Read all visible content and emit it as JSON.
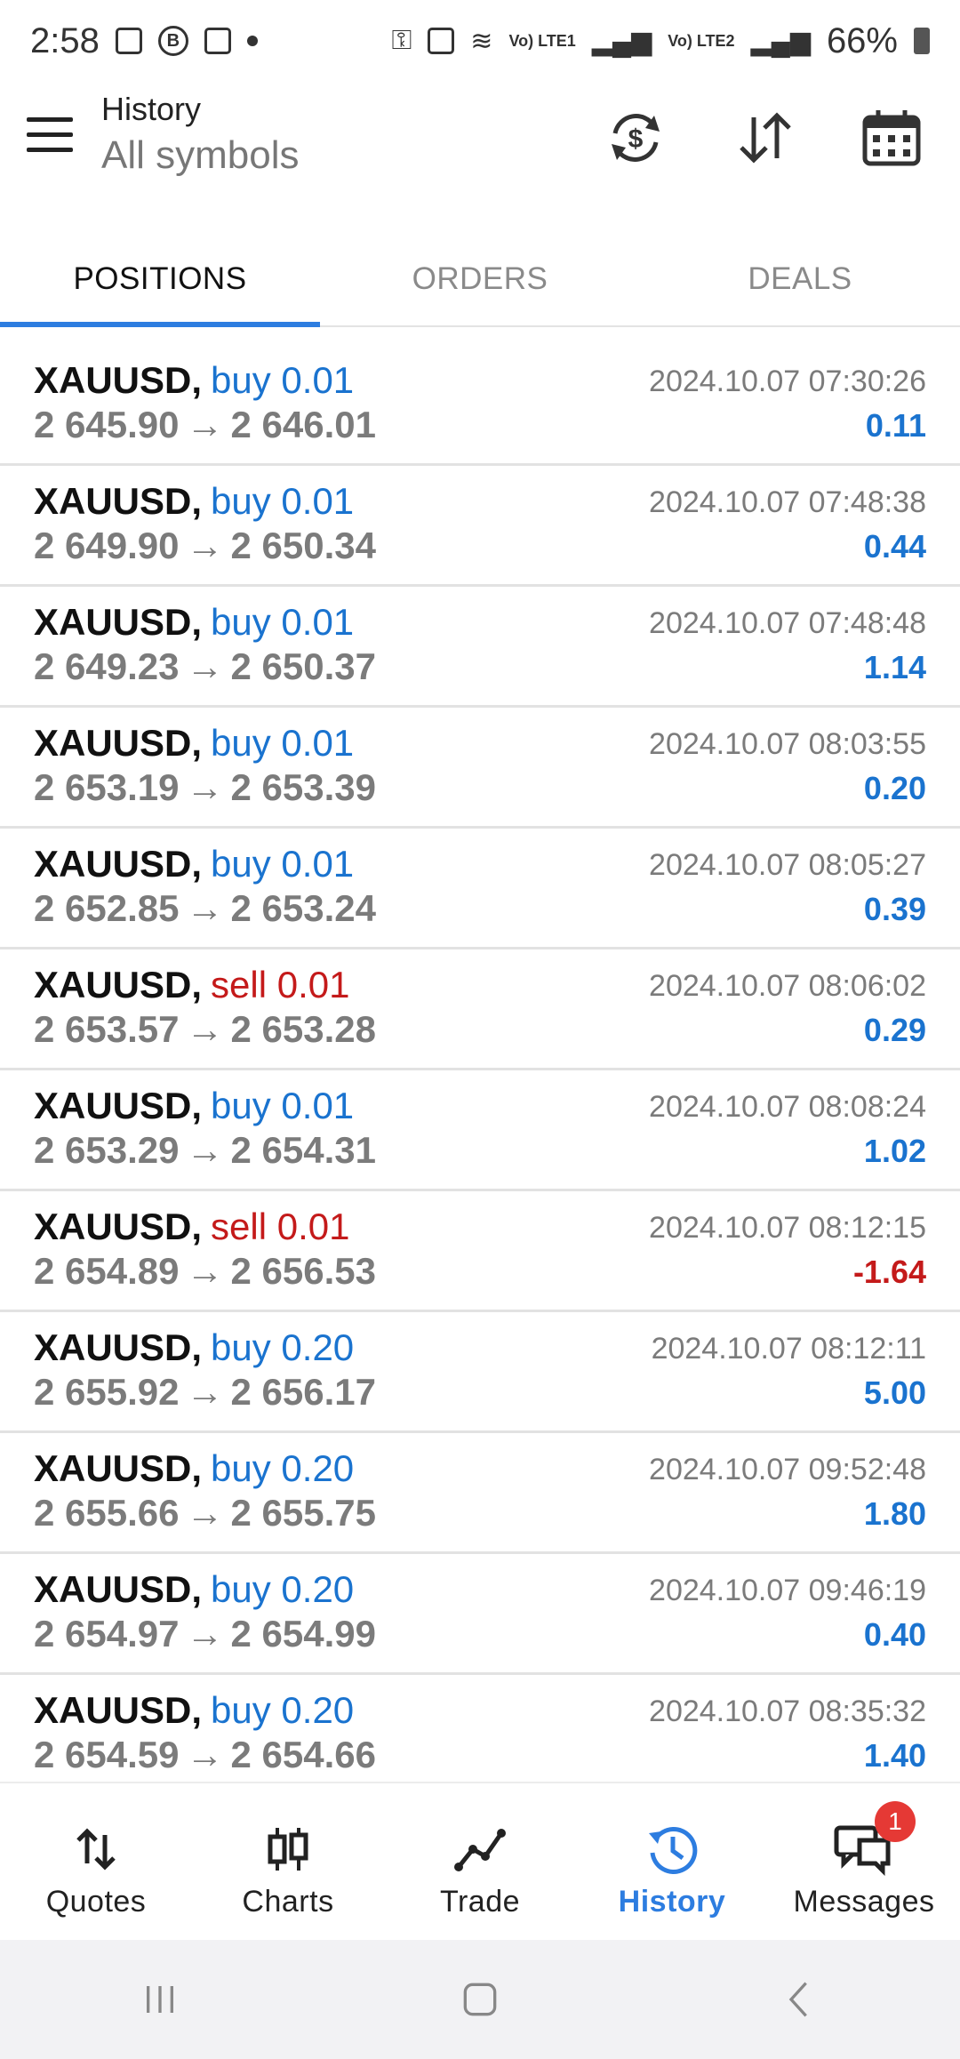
{
  "status_bar": {
    "time": "2:58",
    "battery": "66%",
    "lte1": "Vo) LTE1",
    "lte2": "Vo) LTE2"
  },
  "header": {
    "title": "History",
    "subtitle": "All symbols"
  },
  "tabs": [
    {
      "label": "POSITIONS",
      "active": true
    },
    {
      "label": "ORDERS",
      "active": false
    },
    {
      "label": "DEALS",
      "active": false
    }
  ],
  "positions": [
    {
      "symbol": "XAUUSD,",
      "side": "buy 0.01",
      "side_type": "buy",
      "open": "2 645.90",
      "close": "2 646.01",
      "time": "2024.10.07 07:30:26",
      "profit": "0.11"
    },
    {
      "symbol": "XAUUSD,",
      "side": "buy 0.01",
      "side_type": "buy",
      "open": "2 649.90",
      "close": "2 650.34",
      "time": "2024.10.07 07:48:38",
      "profit": "0.44"
    },
    {
      "symbol": "XAUUSD,",
      "side": "buy 0.01",
      "side_type": "buy",
      "open": "2 649.23",
      "close": "2 650.37",
      "time": "2024.10.07 07:48:48",
      "profit": "1.14"
    },
    {
      "symbol": "XAUUSD,",
      "side": "buy 0.01",
      "side_type": "buy",
      "open": "2 653.19",
      "close": "2 653.39",
      "time": "2024.10.07 08:03:55",
      "profit": "0.20"
    },
    {
      "symbol": "XAUUSD,",
      "side": "buy 0.01",
      "side_type": "buy",
      "open": "2 652.85",
      "close": "2 653.24",
      "time": "2024.10.07 08:05:27",
      "profit": "0.39"
    },
    {
      "symbol": "XAUUSD,",
      "side": "sell 0.01",
      "side_type": "sell",
      "open": "2 653.57",
      "close": "2 653.28",
      "time": "2024.10.07 08:06:02",
      "profit": "0.29"
    },
    {
      "symbol": "XAUUSD,",
      "side": "buy 0.01",
      "side_type": "buy",
      "open": "2 653.29",
      "close": "2 654.31",
      "time": "2024.10.07 08:08:24",
      "profit": "1.02"
    },
    {
      "symbol": "XAUUSD,",
      "side": "sell 0.01",
      "side_type": "sell",
      "open": "2 654.89",
      "close": "2 656.53",
      "time": "2024.10.07 08:12:15",
      "profit": "-1.64"
    },
    {
      "symbol": "XAUUSD,",
      "side": "buy 0.20",
      "side_type": "buy",
      "open": "2 655.92",
      "close": "2 656.17",
      "time": "2024.10.07 08:12:11",
      "profit": "5.00"
    },
    {
      "symbol": "XAUUSD,",
      "side": "buy 0.20",
      "side_type": "buy",
      "open": "2 655.66",
      "close": "2 655.75",
      "time": "2024.10.07 09:52:48",
      "profit": "1.80"
    },
    {
      "symbol": "XAUUSD,",
      "side": "buy 0.20",
      "side_type": "buy",
      "open": "2 654.97",
      "close": "2 654.99",
      "time": "2024.10.07 09:46:19",
      "profit": "0.40"
    },
    {
      "symbol": "XAUUSD,",
      "side": "buy 0.20",
      "side_type": "buy",
      "open": "2 654.59",
      "close": "2 654.66",
      "time": "2024.10.07 08:35:32",
      "profit": "1.40"
    }
  ],
  "arrow_glyph": "→",
  "bottom_nav": [
    {
      "label": "Quotes",
      "icon": "up-down-arrows-icon",
      "active": false
    },
    {
      "label": "Charts",
      "icon": "candlestick-icon",
      "active": false
    },
    {
      "label": "Trade",
      "icon": "trend-line-icon",
      "active": false
    },
    {
      "label": "History",
      "icon": "history-clock-icon",
      "active": true
    },
    {
      "label": "Messages",
      "icon": "chat-bubbles-icon",
      "active": false,
      "badge": "1"
    }
  ],
  "colors": {
    "accent": "#2d7de0",
    "buy": "#1a73cf",
    "sell": "#c41a1a",
    "badge": "#e53935"
  }
}
